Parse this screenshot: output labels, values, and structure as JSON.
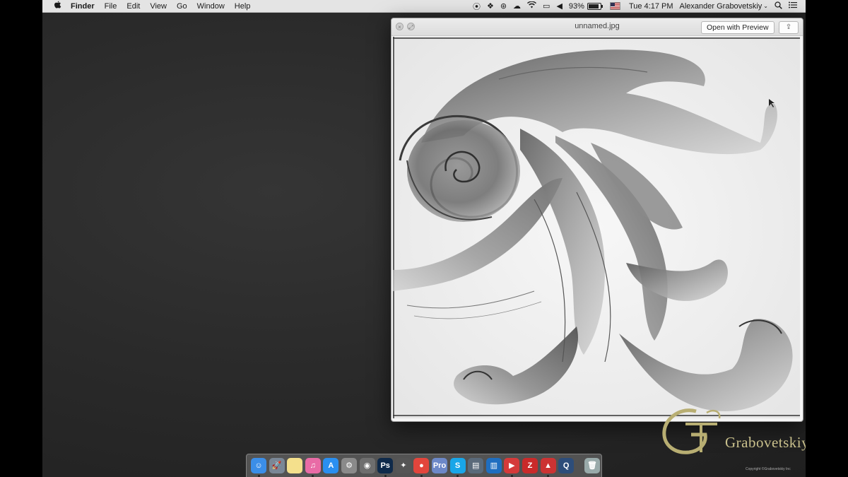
{
  "menubar": {
    "apple_icon": "apple-icon",
    "app_name": "Finder",
    "menus": [
      "File",
      "Edit",
      "View",
      "Go",
      "Window",
      "Help"
    ],
    "battery_percent": "93%",
    "clock": "Tue 4:17 PM",
    "user_name": "Alexander Grabovetskiy",
    "status_icons": [
      "record-icon",
      "dropbox-icon",
      "creative-cloud-icon",
      "cloud-icon",
      "wifi-icon",
      "airplay-icon",
      "volume-icon"
    ]
  },
  "quicklook": {
    "title": "unnamed.jpg",
    "open_button": "Open with Preview",
    "close_glyph": "×",
    "fullscreen_glyph": "⤢",
    "share_glyph": "⇪"
  },
  "watermark": {
    "brand": "Grabovetskiy",
    "copyright": "Copyright ©Grabovetskiy Inc"
  },
  "dock": {
    "apps": [
      {
        "name": "finder",
        "label": "☺",
        "color": "#3b8ee8"
      },
      {
        "name": "launchpad",
        "label": "🚀",
        "color": "#7a8796"
      },
      {
        "name": "notes",
        "label": "",
        "color": "#f4e08c"
      },
      {
        "name": "itunes",
        "label": "♫",
        "color": "#e96ba6"
      },
      {
        "name": "app-store",
        "label": "A",
        "color": "#2a8ff0"
      },
      {
        "name": "system-preferences",
        "label": "⚙",
        "color": "#8a8a8a"
      },
      {
        "name": "photo-app",
        "label": "◉",
        "color": "#6e6e6e"
      },
      {
        "name": "photoshop",
        "label": "Ps",
        "color": "#0f2a4a"
      },
      {
        "name": "final-cut",
        "label": "✦",
        "color": "#555"
      },
      {
        "name": "chrome",
        "label": "●",
        "color": "#e2453c"
      },
      {
        "name": "pro-app",
        "label": "Pro",
        "color": "#6c88c8"
      },
      {
        "name": "skype",
        "label": "S",
        "color": "#19a6e8"
      },
      {
        "name": "screenshot",
        "label": "▤",
        "color": "#5a6a7a"
      },
      {
        "name": "trello",
        "label": "▥",
        "color": "#1f6ec0"
      },
      {
        "name": "player",
        "label": "▶",
        "color": "#d53a3a"
      },
      {
        "name": "filezilla",
        "label": "Z",
        "color": "#c92a2a"
      },
      {
        "name": "pdf-app",
        "label": "▲",
        "color": "#c33"
      },
      {
        "name": "quicktime",
        "label": "Q",
        "color": "#2d4d7a"
      },
      {
        "name": "trash",
        "label": "🗑",
        "color": "#9aa"
      }
    ]
  }
}
